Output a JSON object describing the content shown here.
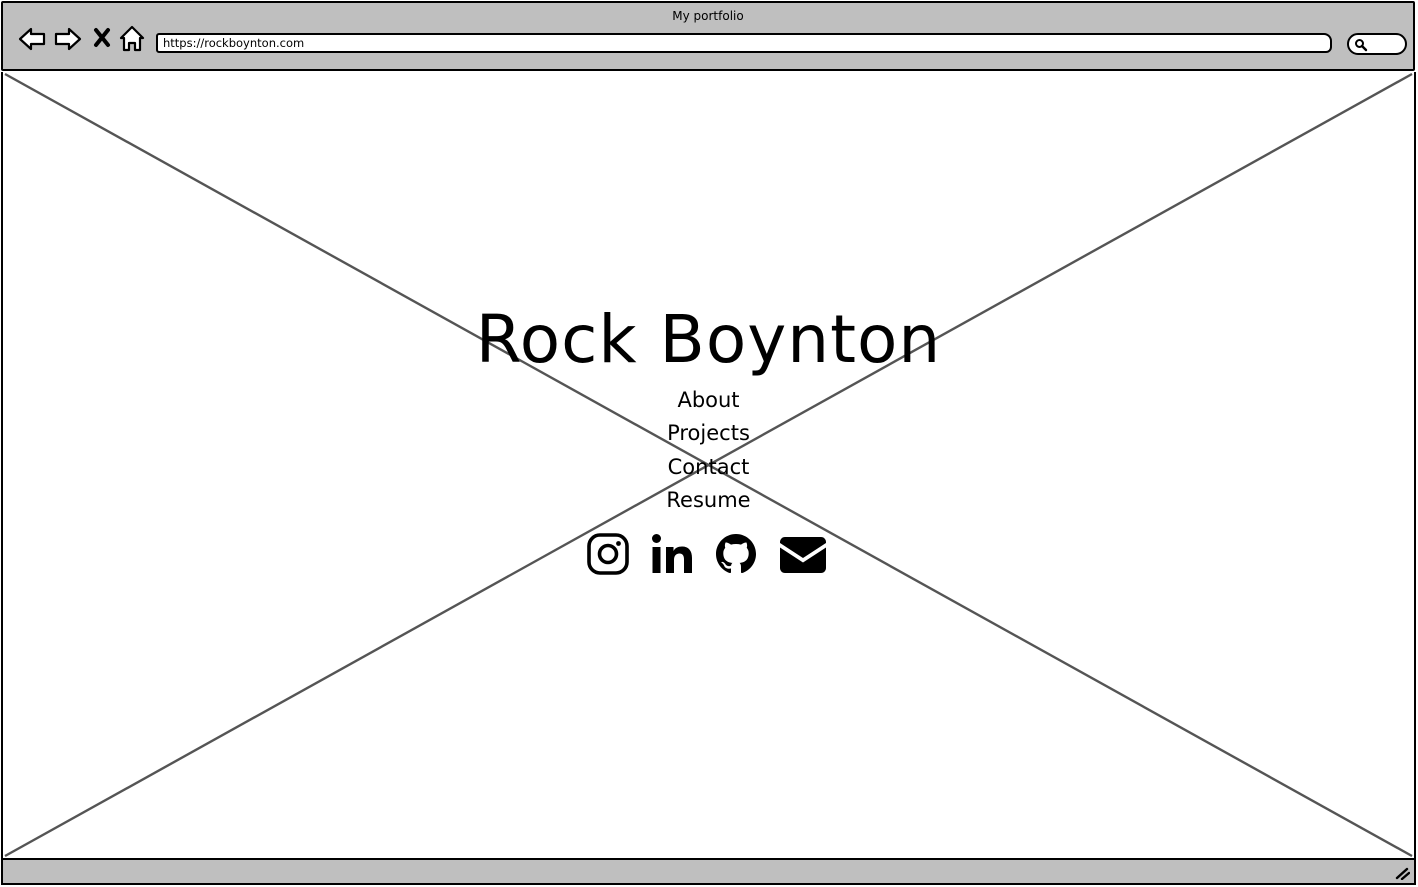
{
  "window": {
    "title": "My portfolio"
  },
  "toolbar": {
    "back_icon": "back-arrow-icon",
    "forward_icon": "forward-arrow-icon",
    "stop_icon": "close-icon",
    "home_icon": "home-icon",
    "url": "https://rockboynton.com",
    "search_icon": "search-icon"
  },
  "page": {
    "name": "Rock Boynton",
    "nav": [
      {
        "label": "About"
      },
      {
        "label": "Projects"
      },
      {
        "label": "Contact"
      },
      {
        "label": "Resume"
      }
    ],
    "social": [
      {
        "icon": "instagram-icon"
      },
      {
        "icon": "linkedin-icon"
      },
      {
        "icon": "github-icon"
      },
      {
        "icon": "email-icon"
      }
    ]
  },
  "colors": {
    "chrome": "#bfbfbf",
    "placeholder_lines": "#555555",
    "text": "#000000"
  }
}
